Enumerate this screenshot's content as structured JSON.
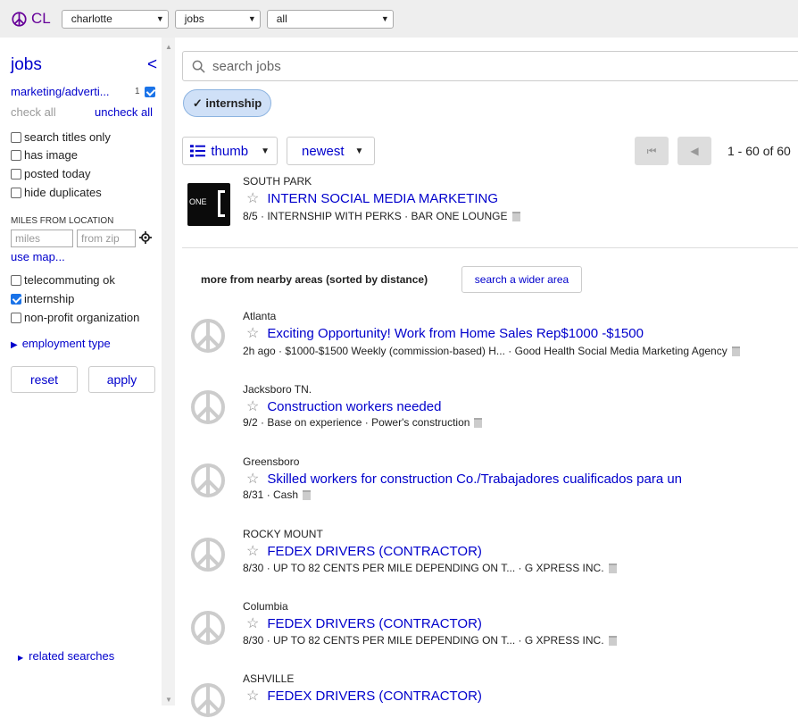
{
  "header": {
    "logo_text": "CL",
    "city": "charlotte",
    "category": "jobs",
    "subcategory": "all"
  },
  "sidebar": {
    "title": "jobs",
    "collapse_glyph": "<",
    "category_filter": "marketing/adverti...",
    "category_count": "1",
    "check_all": "check all",
    "uncheck_all": "uncheck all",
    "options": [
      {
        "label": "search titles only",
        "checked": false
      },
      {
        "label": "has image",
        "checked": false
      },
      {
        "label": "posted today",
        "checked": false
      },
      {
        "label": "hide duplicates",
        "checked": false
      }
    ],
    "miles_heading": "MILES FROM LOCATION",
    "miles_placeholder": "miles",
    "zip_placeholder": "from zip",
    "use_map": "use map...",
    "options2": [
      {
        "label": "telecommuting ok",
        "checked": false
      },
      {
        "label": "internship",
        "checked": true
      },
      {
        "label": "non-profit organization",
        "checked": false
      }
    ],
    "employment_type": "employment type",
    "reset": "reset",
    "apply": "apply",
    "related_searches": "related searches"
  },
  "search": {
    "placeholder": "search jobs"
  },
  "chip": {
    "label": "✓ internship"
  },
  "toolbar": {
    "view_mode": "thumb",
    "sort": "newest",
    "page_count": "1 - 60 of 60"
  },
  "listings": [
    {
      "location": "SOUTH PARK",
      "title": "INTERN SOCIAL MEDIA MARKETING",
      "meta": "8/5  · INTERNSHIP WITH PERKS · BAR ONE LOUNGE",
      "thumb_text": "ONE"
    }
  ],
  "nearby": {
    "heading": "more from nearby areas (sorted by distance)",
    "wider_button": "search a wider area",
    "items": [
      {
        "location": "Atlanta",
        "title": "Exciting Opportunity! Work from Home Sales Rep$1000 -$1500",
        "meta": "2h ago  · $1000-$1500 Weekly (commission-based) H... · Good Health Social Media Marketing Agency"
      },
      {
        "location": "Jacksboro TN.",
        "title": "Construction workers needed",
        "meta": "9/2  · Base on experience · Power's construction"
      },
      {
        "location": "Greensboro",
        "title": "Skilled workers for construction Co./Trabajadores cualificados para un",
        "meta": "8/31  · Cash"
      },
      {
        "location": "ROCKY MOUNT",
        "title": "FEDEX DRIVERS (CONTRACTOR)",
        "meta": "8/30  · UP TO 82 CENTS PER MILE DEPENDING ON T... · G XPRESS INC."
      },
      {
        "location": "Columbia",
        "title": "FEDEX DRIVERS (CONTRACTOR)",
        "meta": "8/30  · UP TO 82 CENTS PER MILE DEPENDING ON T... · G XPRESS INC."
      },
      {
        "location": "ASHVILLE",
        "title": "FEDEX DRIVERS (CONTRACTOR)",
        "meta": ""
      }
    ]
  },
  "colors": {
    "link": "#0000cc",
    "logo": "#660099",
    "chip_bg": "#cfe0f7",
    "checkbox_on": "#1a73e8"
  }
}
